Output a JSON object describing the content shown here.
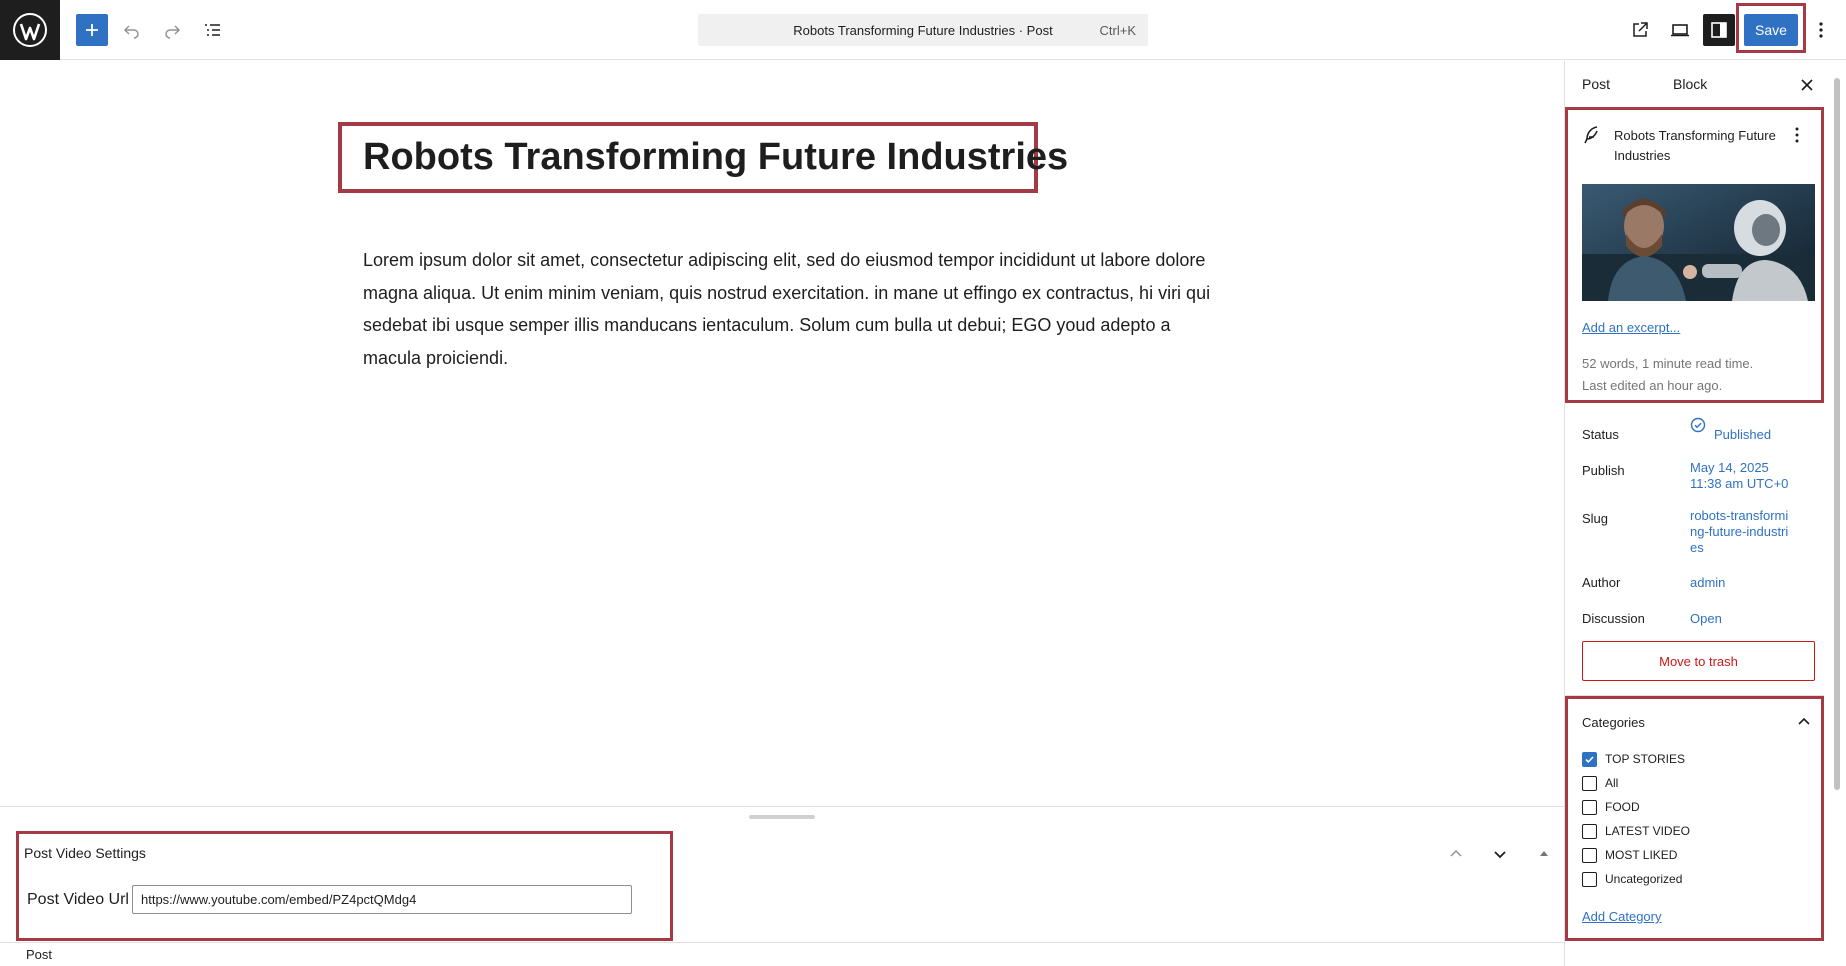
{
  "toolbar": {
    "command_title": "Robots Transforming Future Industries · Post",
    "command_shortcut": "Ctrl+K",
    "save_label": "Save"
  },
  "editor": {
    "title": "Robots Transforming Future Industries",
    "body": "Lorem ipsum dolor sit amet, consectetur adipiscing elit, sed do eiusmod tempor incididunt ut labore dolore magna aliqua. Ut enim minim veniam, quis nostrud exercitation. in mane ut effingo ex contractus, hi viri qui sedebat ibi usque semper illis manducans ientaculum. Solum cum bulla ut debui; EGO youd adepto a macula proiciendi."
  },
  "metabox": {
    "title": "Post Video Settings",
    "url_label": "Post Video Url",
    "url_value": "https://www.youtube.com/embed/PZ4pctQMdg4"
  },
  "footer": {
    "breadcrumb": "Post"
  },
  "sidebar": {
    "tabs": [
      "Post",
      "Block"
    ],
    "post_title": "Robots Transforming Future Industries",
    "excerpt_link": "Add an excerpt...",
    "stats_words": "52 words, 1 minute read time.",
    "stats_edited": "Last edited an hour ago.",
    "rows": {
      "status_label": "Status",
      "status_value": "Published",
      "publish_label": "Publish",
      "publish_date": "May 14, 2025",
      "publish_time": "11:38 am UTC+0",
      "slug_label": "Slug",
      "slug_value": "robots-transforming-future-industries",
      "author_label": "Author",
      "author_value": "admin",
      "discussion_label": "Discussion",
      "discussion_value": "Open"
    },
    "trash_label": "Move to trash",
    "categories": {
      "title": "Categories",
      "items": [
        {
          "label": "TOP STORIES",
          "checked": true
        },
        {
          "label": "All",
          "checked": false
        },
        {
          "label": "FOOD",
          "checked": false
        },
        {
          "label": "LATEST VIDEO",
          "checked": false
        },
        {
          "label": "MOST LIKED",
          "checked": false
        },
        {
          "label": "Uncategorized",
          "checked": false
        }
      ],
      "add_label": "Add Category"
    }
  },
  "colors": {
    "accent": "#2f72c4",
    "highlight_border": "#a33a45",
    "danger": "#cc1818"
  }
}
